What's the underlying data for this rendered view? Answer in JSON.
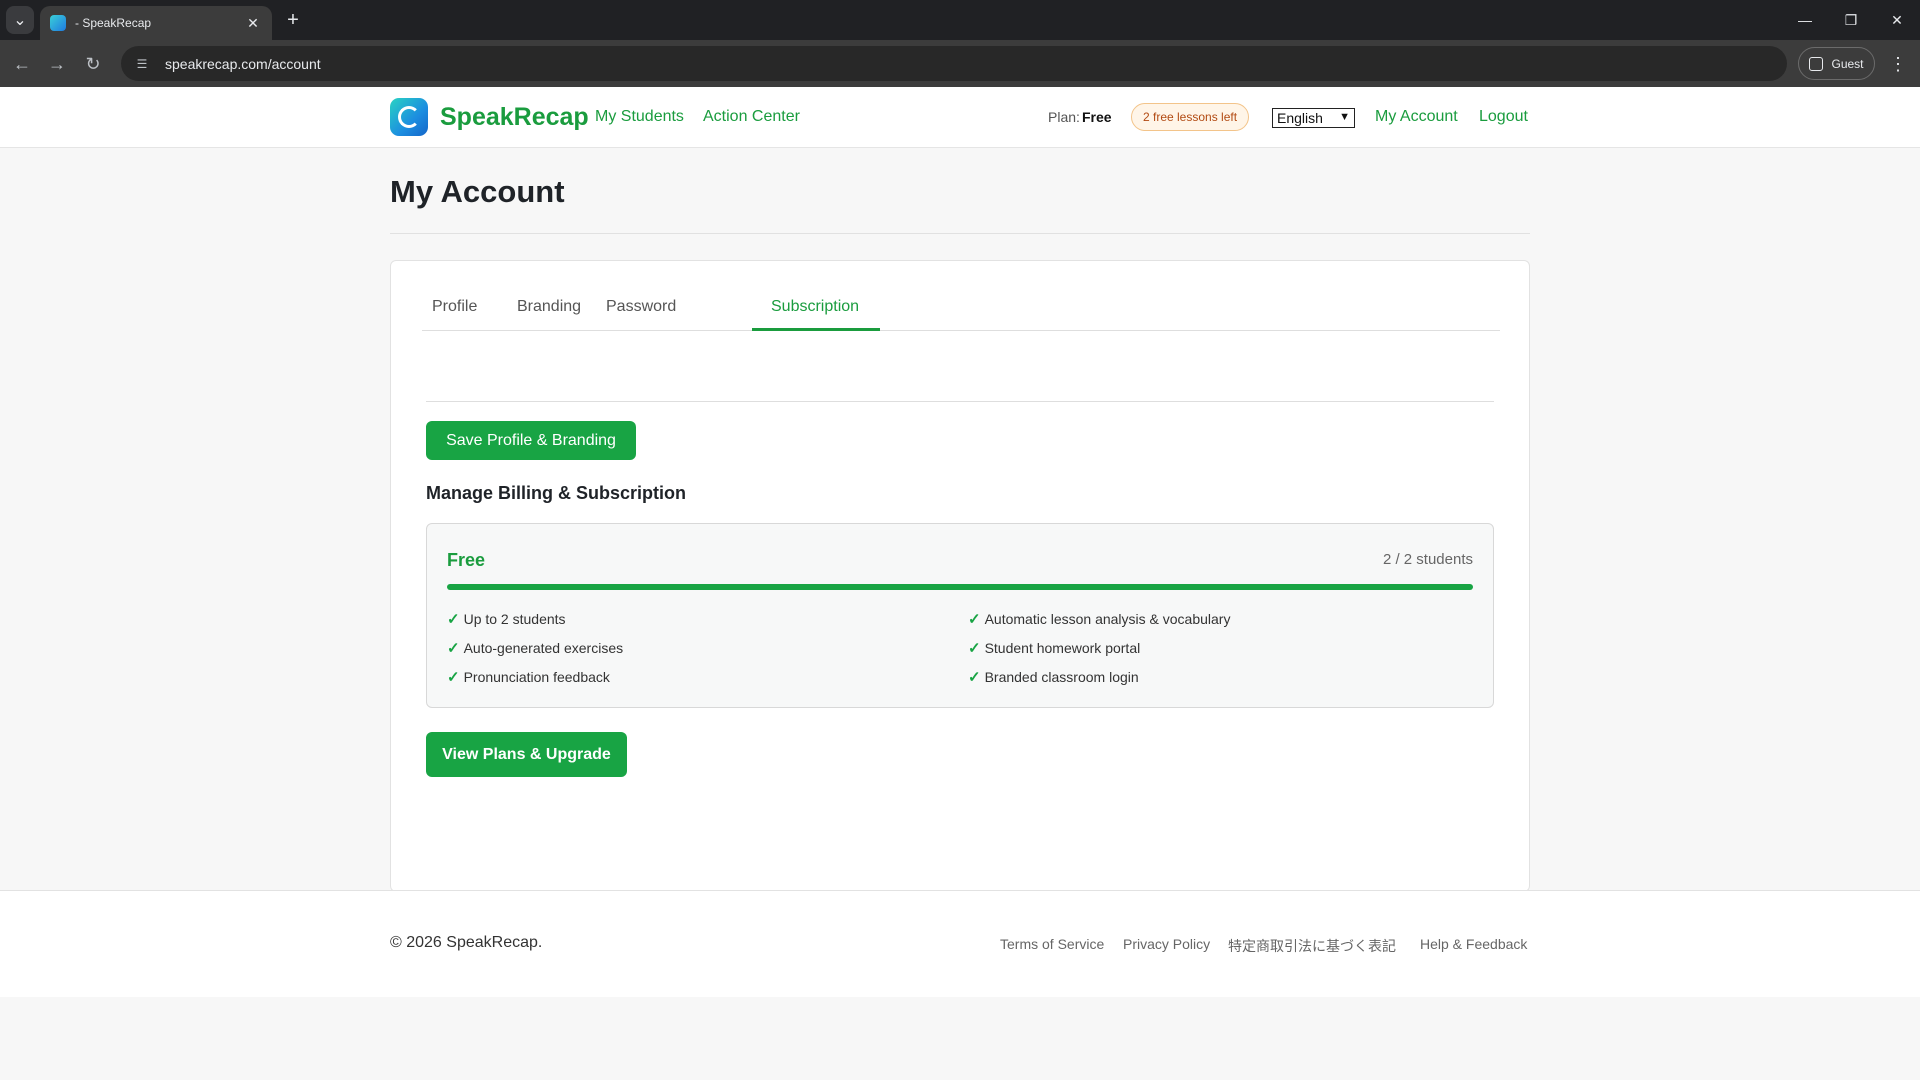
{
  "browser": {
    "tab_title": "- SpeakRecap",
    "url": "speakrecap.com/account",
    "profile_label": "Guest"
  },
  "header": {
    "brand": "SpeakRecap",
    "nav": [
      "My Students",
      "Action Center"
    ],
    "plan_label": "Plan:",
    "plan_value": "Free",
    "lessons_badge": "2 free lessons left",
    "language": "English",
    "my_account": "My Account",
    "logout": "Logout"
  },
  "main": {
    "title": "My Account",
    "tabs": [
      "Profile",
      "Branding",
      "Password",
      "Subscription"
    ],
    "active_tab": "Subscription",
    "save_button": "Save Profile & Branding",
    "billing_title": "Manage Billing & Subscription",
    "plan": {
      "name": "Free",
      "usage_text": "2 / 2 students",
      "usage_fraction": 1.0,
      "features_left": [
        "Up to 2 students",
        "Auto-generated exercises",
        "Pronunciation feedback"
      ],
      "features_right": [
        "Automatic lesson analysis & vocabulary",
        "Student homework portal",
        "Branded classroom login"
      ]
    },
    "upgrade_button": "View Plans & Upgrade"
  },
  "footer": {
    "copyright": "© 2026 SpeakRecap.",
    "links": [
      "Terms of Service",
      "Privacy Policy",
      "特定商取引法に基づく表記",
      "Help & Feedback"
    ]
  },
  "colors": {
    "brand_green": "#1a9c3e",
    "button_green": "#18a444"
  },
  "icons": [
    "tab-list-icon",
    "favicon-icon",
    "close-icon",
    "plus-icon",
    "back-icon",
    "forward-icon",
    "reload-icon",
    "site-info-icon",
    "profile-icon",
    "kebab-menu-icon",
    "logo-icon",
    "check-icon"
  ]
}
